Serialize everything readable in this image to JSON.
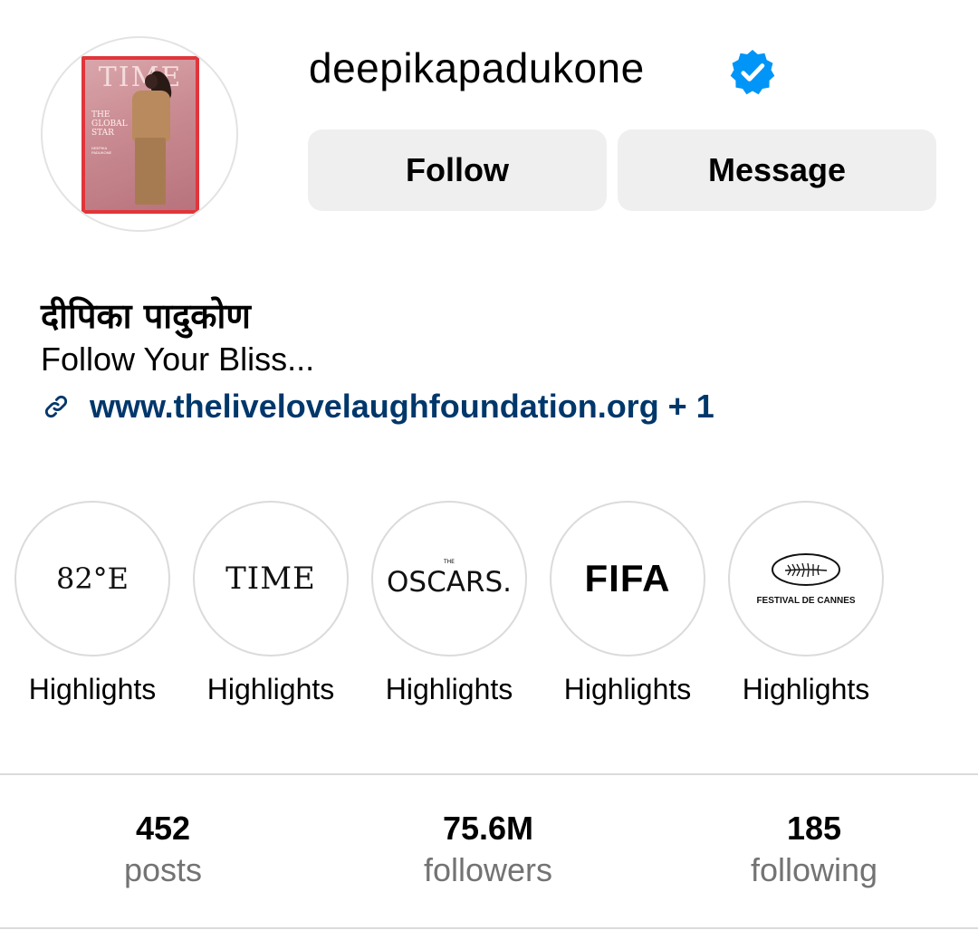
{
  "profile": {
    "username": "deepikapadukone",
    "verified_icon": "verified-badge-icon",
    "display_name": "दीपिका पादुकोण",
    "bio": "Follow Your Bliss...",
    "link": "www.thelivelovelaughfoundation.org + 1",
    "avatar": {
      "masthead": "TIME",
      "headline": "THE GLOBAL STAR",
      "subline": "DEEPIKA PADUKONE"
    }
  },
  "actions": {
    "follow_label": "Follow",
    "message_label": "Message"
  },
  "highlights": [
    {
      "logo": "82°E",
      "label": "Highlights"
    },
    {
      "logo": "TIME",
      "label": "Highlights"
    },
    {
      "logo_small": "THE",
      "logo": "OSCARS.",
      "label": "Highlights"
    },
    {
      "logo": "FIFA",
      "label": "Highlights"
    },
    {
      "logo": "FESTIVAL DE CANNES",
      "label": "Highlights"
    }
  ],
  "stats": [
    {
      "value": "452",
      "label": "posts"
    },
    {
      "value": "75.6M",
      "label": "followers"
    },
    {
      "value": "185",
      "label": "following"
    }
  ],
  "colors": {
    "verified_blue": "#0095f6",
    "link_blue": "#00376b",
    "button_bg": "#efefef",
    "muted_text": "#737373",
    "time_cover_red": "#e0353b"
  }
}
